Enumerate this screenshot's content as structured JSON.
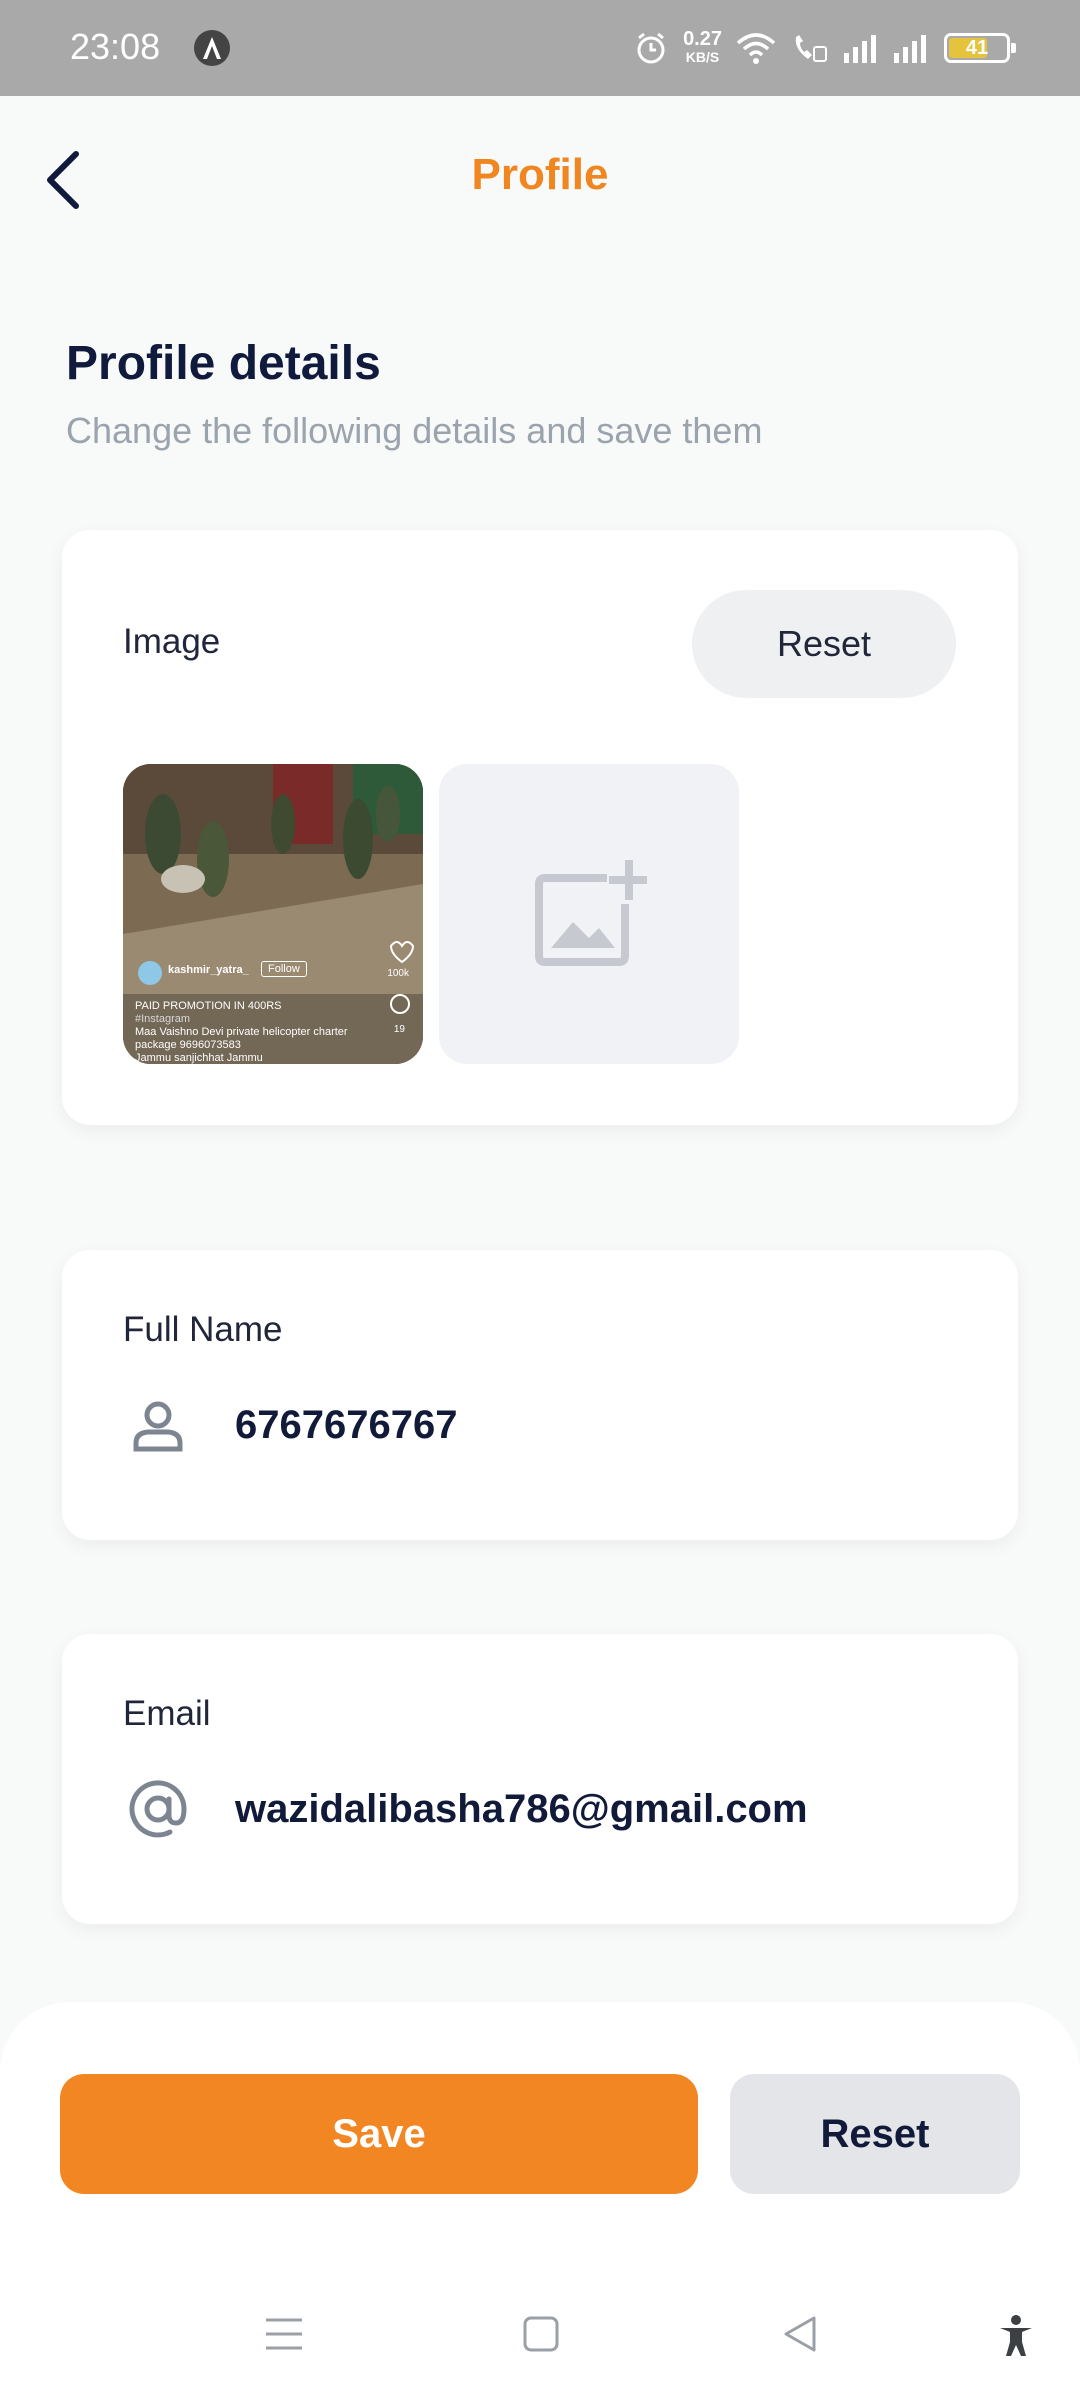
{
  "status_bar": {
    "time": "23:08",
    "net_speed_value": "0.27",
    "net_speed_unit": "KB/S",
    "battery": "41"
  },
  "header": {
    "title": "Profile"
  },
  "section": {
    "title": "Profile details",
    "subtitle": "Change the following details and save them"
  },
  "image_card": {
    "label": "Image",
    "reset_label": "Reset",
    "thumbnail": {
      "username": "kashmir_yatra_",
      "follow": "Follow",
      "line1": "PAID PROMOTION IN 400RS",
      "tag": "#Instagram",
      "line2": "Maa Vaishno Devi  private helicopter charter",
      "line3": "package  9696073583",
      "line4": "Jammu sanjichhat Jammu",
      "likes": "100k",
      "comments": "19"
    }
  },
  "name_card": {
    "label": "Full Name",
    "value": "6767676767"
  },
  "email_card": {
    "label": "Email",
    "value": "wazidalibasha786@gmail.com"
  },
  "actions": {
    "save_label": "Save",
    "reset_label": "Reset"
  },
  "colors": {
    "accent": "#f28623",
    "title_orange": "#f0861f",
    "dark_text": "#121a3a"
  }
}
